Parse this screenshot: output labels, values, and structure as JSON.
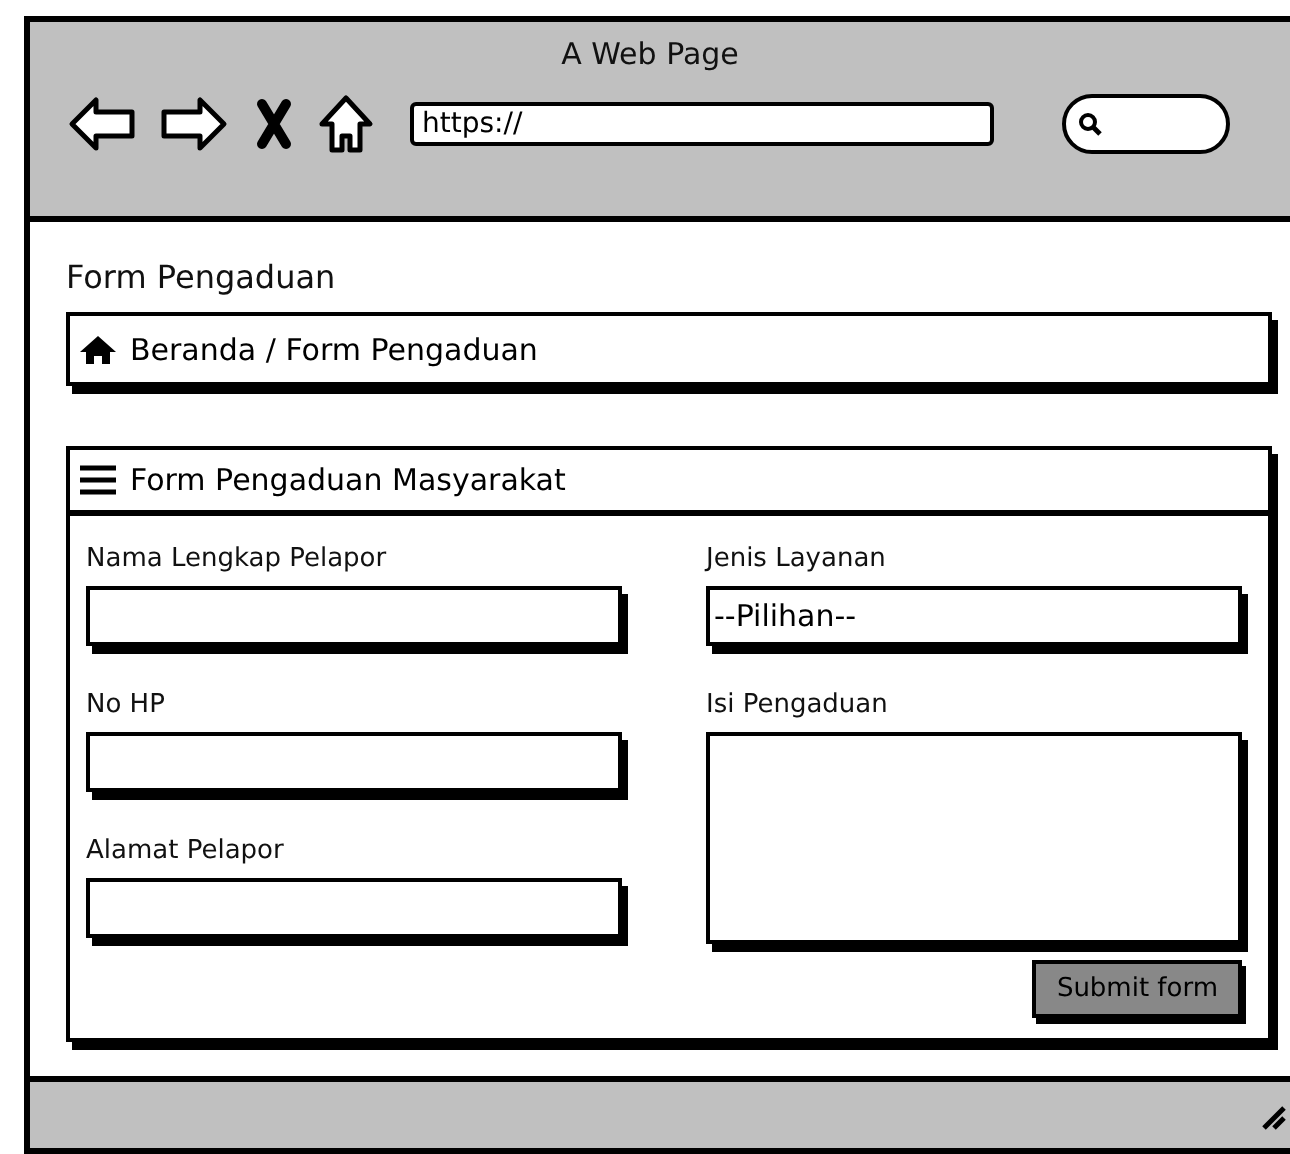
{
  "window": {
    "title": "A Web Page",
    "address": "https://"
  },
  "page_title": "Form Pengaduan",
  "breadcrumb": "Beranda / Form Pengaduan",
  "panel": {
    "title": "Form Pengaduan Masyarakat",
    "left_fields": [
      {
        "label": "Nama Lengkap Pelapor",
        "kind": "text"
      },
      {
        "label": "No HP",
        "kind": "text"
      },
      {
        "label": "Alamat Pelapor",
        "kind": "text"
      }
    ],
    "right_fields": [
      {
        "label": "Jenis Layanan",
        "kind": "select",
        "value": "--Pilihan--"
      },
      {
        "label": "Isi Pengaduan",
        "kind": "textarea"
      }
    ],
    "submit": "Submit form"
  }
}
